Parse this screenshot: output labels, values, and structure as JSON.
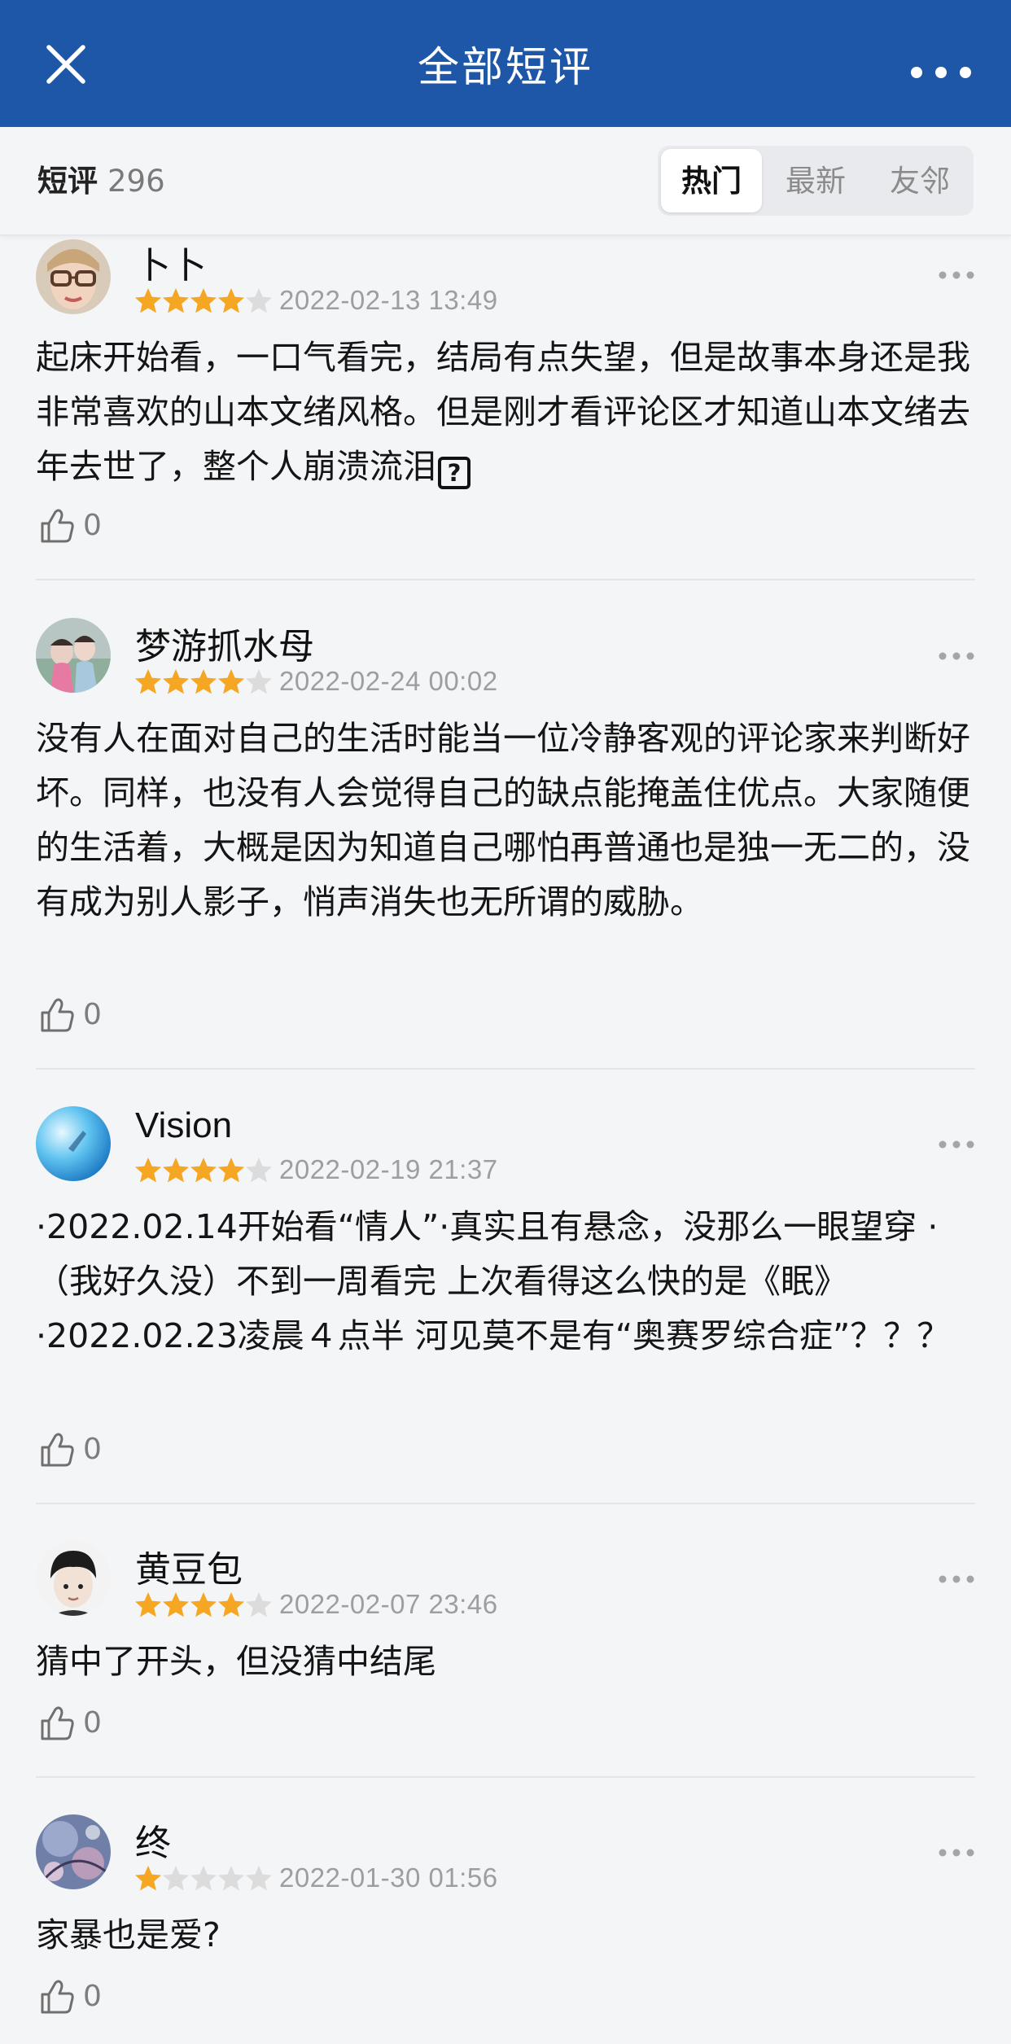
{
  "header": {
    "title": "全部短评",
    "close_icon": "close-icon",
    "more_icon": "more-horizontal-icon"
  },
  "subbar": {
    "label": "短评",
    "count": "296",
    "tabs": [
      {
        "label": "热门",
        "active": true
      },
      {
        "label": "最新",
        "active": false
      },
      {
        "label": "友邻",
        "active": false
      }
    ]
  },
  "comments": [
    {
      "user": "卜卜",
      "rating": 4,
      "date": "2022-02-13 13:49",
      "text": "起床开始看，一口气看完，结局有点失望，但是故事本身还是我非常喜欢的山本文绪风格。但是刚才看评论区才知道山本文绪去年去世了，整个人崩溃流泪",
      "emoji_glyph": "?",
      "likes": "0"
    },
    {
      "user": "梦游抓水母",
      "rating": 4,
      "date": "2022-02-24 00:02",
      "text": "没有人在面对自己的生活时能当一位冷静客观的评论家来判断好坏。同样，也没有人会觉得自己的缺点能掩盖住优点。大家随便的生活着，大概是因为知道自己哪怕再普通也是独一无二的，没有成为别人影子，悄声消失也无所谓的威胁。",
      "likes": "0"
    },
    {
      "user": "Vision",
      "rating": 4,
      "date": "2022-02-19 21:37",
      "text": "·2022.02.14开始看“情人”·真实且有悬念，没那么一眼望穿 ·（我好久没）不到一周看完  上次看得这么快的是《眠》 ·2022.02.23凌晨４点半  河见莫不是有“奥赛罗综合症”？？？",
      "likes": "0"
    },
    {
      "user": "黄豆包",
      "rating": 4,
      "date": "2022-02-07 23:46",
      "text": "猜中了开头，但没猜中结尾",
      "likes": "0"
    },
    {
      "user": "终",
      "rating": 1,
      "date": "2022-01-30 01:56",
      "text": "家暴也是爱?",
      "likes": "0"
    }
  ],
  "colors": {
    "nav_bg": "#1f57a8",
    "page_bg": "#f4f5f7",
    "star_on": "#f5a623",
    "star_off": "#dcdcdc"
  }
}
